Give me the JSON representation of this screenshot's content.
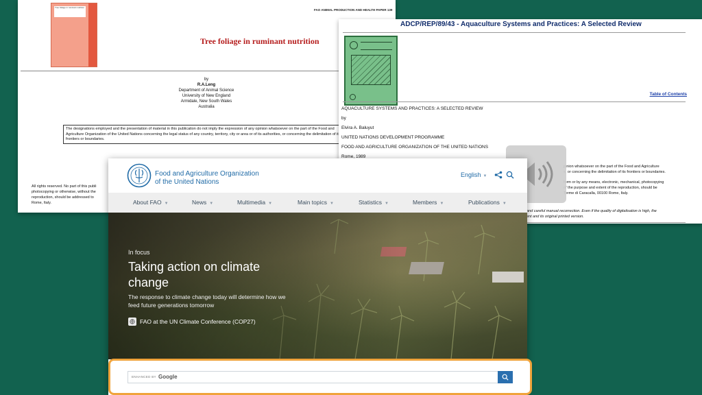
{
  "doc1": {
    "series": "FAO ANIMAL PRODUCTION AND HEALTH PAPER 139",
    "cover_title": "Tree foliage in ruminant nutrition",
    "title": "Tree foliage in ruminant nutrition",
    "by": "by",
    "author": "R.A.Leng",
    "affiliation": [
      "Department of Animal Science",
      "University of New England",
      "Armidale, New South Wales",
      "Australia"
    ],
    "disclaimer": "The designations employed and the presentation of material in this publication do not imply the expression of any opinion whatsoever on the part of the Food and Agriculture Organization of the United Nations concerning the legal status of any country, territory, city or area or of its authorities, or concerning the delimitation of its frontiers or boundaries.",
    "rights": [
      "All rights reserved. No part of this publi",
      "photocopying or otherwise, without the",
      "reproduction, should be addressed to",
      "Rome, Italy."
    ]
  },
  "doc2": {
    "title": "ADCP/REP/89/43 - Aquaculture Systems and Practices: A Selected Review",
    "toc": "Table of Contents",
    "meta": {
      "title_caps": "AQUACULTURE SYSTEMS AND PRACTICES: A SELECTED REVIEW",
      "by": "by",
      "author": "Elvira A. Baluyut",
      "org1": "UNITED NATIONS DEVELOPMENT PROGRAMME",
      "org2": "FOOD AND AGRICULTURE ORGANIZATION OF THE UNITED NATIONS",
      "place": "Rome, 1989"
    },
    "right_text1": [
      "pinion whatsoever on the part of the Food and Agriculture",
      "s, or concerning the delimitation of its frontiers or boundaries."
    ],
    "right_text2": [
      "form or by any means, electronic, mechanical, photocopying",
      "of the purpose and extent of the reproduction, should be",
      "Terme di Caracalla, 00100 Rome, Italy."
    ],
    "right_text3": [
      "and careful manual recorrection. Even if the quality of digitalisation is high, the",
      "ent and its original printed version."
    ]
  },
  "fao": {
    "org_line1": "Food and Agriculture Organization",
    "org_line2": "of the United Nations",
    "language": "English",
    "nav": [
      "About FAO",
      "News",
      "Multimedia",
      "Main topics",
      "Statistics",
      "Members",
      "Publications"
    ],
    "hero": {
      "kicker": "In focus",
      "headline": "Taking action on climate change",
      "lead": "The response to climate change today will determine how we feed future generations tomorrow",
      "link": "FAO at the UN Climate Conference (COP27)"
    }
  },
  "search": {
    "enhanced_by": "ENHANCED BY",
    "google": "Google"
  },
  "colors": {
    "background": "#12624f",
    "fao_blue": "#1f6aa6",
    "doc1_title_red": "#b51d1d",
    "search_highlight": "#f0a33b",
    "search_button": "#2a6faf"
  }
}
